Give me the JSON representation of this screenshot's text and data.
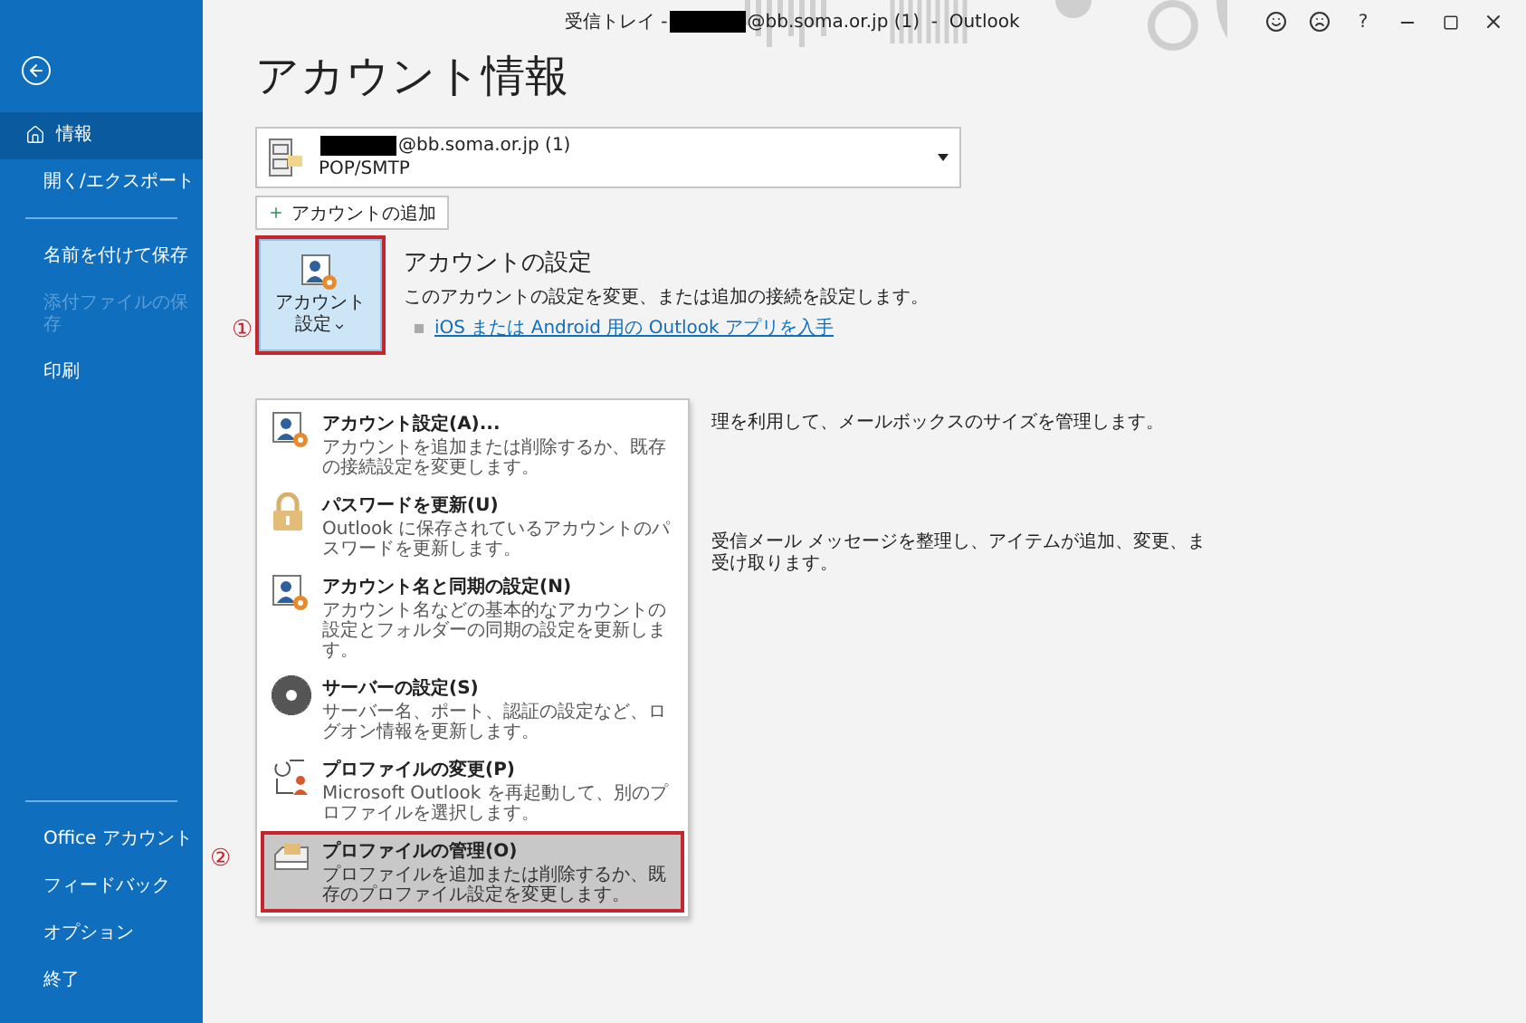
{
  "window": {
    "title_prefix": "受信トレイ -",
    "title_redacted": true,
    "title_suffix": "@bb.soma.or.jp (1)  -  Outlook",
    "help": "?"
  },
  "sidebar": {
    "items": [
      {
        "label": "情報",
        "selected": true,
        "disabled": false,
        "kind": "home"
      },
      {
        "label": "開く/エクスポート",
        "selected": false,
        "disabled": false,
        "kind": "plain"
      },
      {
        "label": "名前を付けて保存",
        "selected": false,
        "disabled": false,
        "kind": "divided"
      },
      {
        "label": "添付ファイルの保存",
        "selected": false,
        "disabled": true,
        "kind": "plain"
      },
      {
        "label": "印刷",
        "selected": false,
        "disabled": false,
        "kind": "plain"
      }
    ],
    "bottom_items": [
      {
        "label": "Office アカウント",
        "selected": false
      },
      {
        "label": "フィードバック",
        "selected": false
      },
      {
        "label": "オプション",
        "selected": false
      },
      {
        "label": "終了",
        "selected": false
      }
    ]
  },
  "page_title": "アカウント情報",
  "account_selector": {
    "address_redacted": true,
    "address": "@bb.soma.or.jp (1)",
    "type": "POP/SMTP"
  },
  "add_account_button": {
    "label": "アカウントの追加"
  },
  "account_settings": {
    "button_lines": [
      "アカウント",
      "設定"
    ],
    "highlighted": true,
    "heading": "アカウントの設定",
    "description": "このアカウントの設定を変更、または追加の接続を設定します。",
    "link": "iOS または Android 用の Outlook アプリを入手"
  },
  "menu": {
    "items": [
      {
        "title": "アカウント設定(A)...",
        "description": "アカウントを追加または削除するか、既存の接続設定を変更します。",
        "selected": false
      },
      {
        "title": "パスワードを更新(U)",
        "description": "Outlook に保存されているアカウントのパスワードを更新します。",
        "selected": false
      },
      {
        "title": "アカウント名と同期の設定(N)",
        "description": "アカウント名などの基本的なアカウントの設定とフォルダーの同期の設定を更新します。",
        "selected": false
      },
      {
        "title": "サーバーの設定(S)",
        "description": "サーバー名、ポート、認証の設定など、ログオン情報を更新します。",
        "selected": false
      },
      {
        "title": "プロファイルの変更(P)",
        "description": "Microsoft Outlook を再起動して、別のプロファイルを選択します。",
        "selected": false
      },
      {
        "title": "プロファイルの管理(O)",
        "description": "プロファイルを追加または削除するか、既存のプロファイル設定を変更します。",
        "selected": true
      }
    ]
  },
  "background_sections": [
    {
      "lines": [
        "理を利用して、メールボックスのサイズを管理します。"
      ]
    },
    {
      "lines": [
        "受信メール メッセージを整理し、アイテムが追加、変更、ま",
        "受け取ります。"
      ]
    }
  ],
  "annotations": [
    {
      "label": "①"
    },
    {
      "label": "②"
    }
  ]
}
